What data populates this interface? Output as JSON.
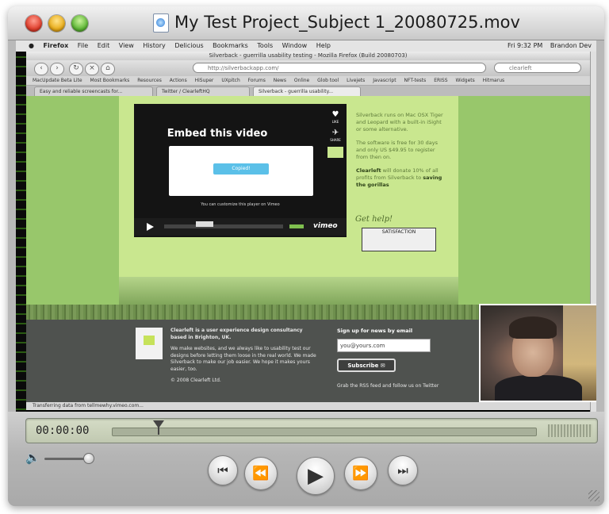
{
  "window": {
    "title": "My Test Project_Subject 1_20080725.mov"
  },
  "recording": {
    "menubar": {
      "apple": "●",
      "items": [
        "Firefox",
        "File",
        "Edit",
        "View",
        "History",
        "Delicious",
        "Bookmarks",
        "Tools",
        "Window",
        "Help"
      ],
      "clock": "Fri 9:32 PM",
      "user": "Brandon Dev"
    },
    "browser": {
      "title": "Silverback - guerrilla usability testing - Mozilla Firefox (Build 20080703)",
      "url": "http://silverbackapp.com/",
      "search_placeholder": "clearleft",
      "bookmarks": [
        "MacUpdate Beta Lite",
        "Most Bookmarks",
        "Resources",
        "Actions",
        "HiSuper",
        "UXpitch",
        "Forums",
        "News",
        "Online",
        "Glob tool",
        "Livejets",
        "Javascript",
        "NFT-tests",
        "ERISS",
        "Widgets",
        "Hitmarus"
      ],
      "tabs": [
        "Easy and reliable screencasts for...",
        "Twitter / ClearleftHQ",
        "Silverback - guerrilla usability..."
      ],
      "status": "Transferring data from tellmewhy.vimeo.com..."
    },
    "page": {
      "embed_title": "Embed this video",
      "copied_label": "Copied!",
      "customize_text": "You can customize this player on Vimeo",
      "like_label": "LIKE",
      "share_label": "SHARE",
      "vimeo_logo": "vimeo",
      "side_p1": "Silverback runs on Mac OSX Tiger and Leopard with a built-in iSight or some alternative.",
      "side_p2": "The software is free for 30 days and only US $49.95 to register from then on.",
      "side_p3_bold": "Clearleft",
      "side_p3": "will donate 10% of all profits from Silverback to",
      "side_p3_link": "saving the gorillas",
      "help_text": "Get help!",
      "satisfaction_text": "SATISFACTION",
      "footer_heading": "Clearleft is a user experience design consultancy based in Brighton, UK.",
      "footer_body": "We make websites, and we always like to usability test our designs before letting them loose in the real world. We made Silverback to make our job easier. We hope it makes yours easier, too.",
      "footer_copyright": "© 2008 Clearleft Ltd.",
      "logo_text": "clearleft",
      "signup_heading": "Sign up for news by email",
      "email_value": "you@yours.com",
      "subscribe_label": "Subscribe ✉",
      "rss_text": "Grab the RSS feed and follow us on Twitter"
    }
  },
  "player": {
    "current_time": "00:00:00",
    "playhead_fraction": 0.06,
    "volume_fraction": 0.9,
    "icons": {
      "volume": "volume-icon",
      "skip_back": "⏮",
      "rewind": "⏪",
      "play": "▶",
      "fast_forward": "⏩",
      "skip_forward": "⏭"
    }
  }
}
